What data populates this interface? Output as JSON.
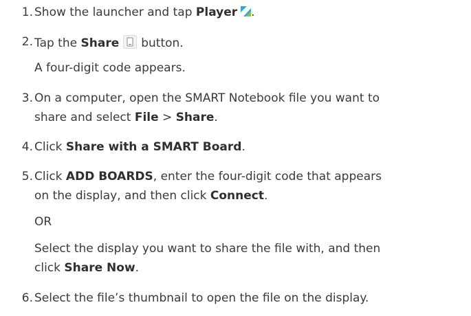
{
  "steps": [
    {
      "number": "1.",
      "pre": "Show the launcher and tap ",
      "bold": "Player",
      "post": "."
    },
    {
      "number": "2.",
      "pre": "Tap the ",
      "bold": "Share",
      "post": "button.",
      "note": "A four-digit code appears."
    },
    {
      "number": "3.",
      "line1": "On a computer, open the SMART Notebook file you want to",
      "line2_pre": "share and select ",
      "bold1": "File",
      "sep": " > ",
      "bold2": "Share",
      "post": "."
    },
    {
      "number": "4.",
      "pre": "Click ",
      "bold": "Share with a SMART Board",
      "post": "."
    },
    {
      "number": "5.",
      "pre": "Click ",
      "bold1": "ADD BOARDS",
      "mid": ", enter the four-digit code that appears",
      "line2_pre": "on the display, and then click ",
      "bold2": "Connect",
      "post": ".",
      "or": "OR",
      "alt_line1": "Select the display you want to share the file with, and then",
      "alt_line2_pre": "click ",
      "alt_bold": "Share Now",
      "alt_post": "."
    },
    {
      "number": "6.",
      "text": "Select the file’s thumbnail to open the file on the display."
    }
  ]
}
